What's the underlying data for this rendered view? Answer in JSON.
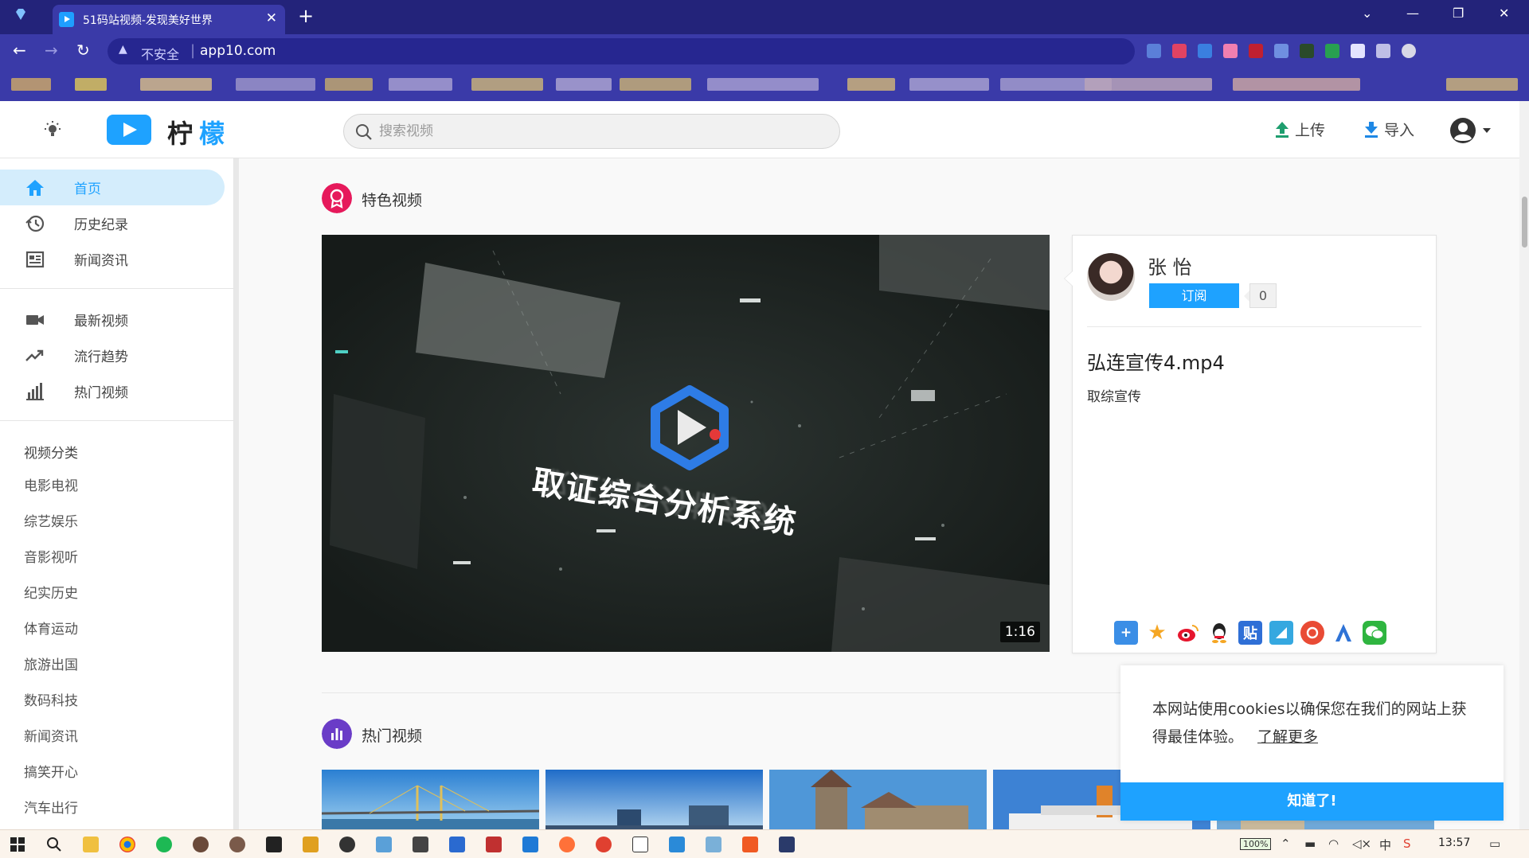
{
  "browser": {
    "tab_title": "51码站视频-发现美好世界",
    "insecure_label": "不安全",
    "url": "app10.com"
  },
  "header": {
    "logo_part1": "柠",
    "logo_part2": "檬",
    "search_placeholder": "搜索视频",
    "upload_label": "上传",
    "import_label": "导入"
  },
  "sidebar": {
    "nav": [
      {
        "label": "首页",
        "icon": "home-icon",
        "active": true
      },
      {
        "label": "历史纪录",
        "icon": "history-icon"
      },
      {
        "label": "新闻资讯",
        "icon": "news-icon"
      }
    ],
    "nav2": [
      {
        "label": "最新视频",
        "icon": "videocam-icon"
      },
      {
        "label": "流行趋势",
        "icon": "trending-icon"
      },
      {
        "label": "热门视频",
        "icon": "bar-chart-icon"
      }
    ],
    "category_title": "视频分类",
    "categories": [
      "电影电视",
      "综艺娱乐",
      "音影视听",
      "纪实历史",
      "体育运动",
      "旅游出国",
      "数码科技",
      "新闻资讯",
      "搞笑开心",
      "汽车出行"
    ]
  },
  "featured": {
    "section_title": "特色视频",
    "video_overlay_title": "取证综合分析系统",
    "duration": "1:16",
    "author": "张 怡",
    "subscribe_label": "订阅",
    "subscribe_count": "0",
    "video_name": "弘连宣传4.mp4",
    "video_desc": "取综宣传"
  },
  "hot": {
    "section_title": "热门视频"
  },
  "cookie": {
    "text": "本网站使用cookies以确保您在我们的网站上获得最佳体验。",
    "link": "了解更多",
    "button": "知道了!"
  },
  "taskbar": {
    "battery": "100%",
    "clock": "13:57"
  },
  "colors": {
    "accent": "#1ea2ff",
    "featured_badge": "#e6195b",
    "hot_badge": "#6a3cc7",
    "browser_frame": "#3a3aa8"
  }
}
